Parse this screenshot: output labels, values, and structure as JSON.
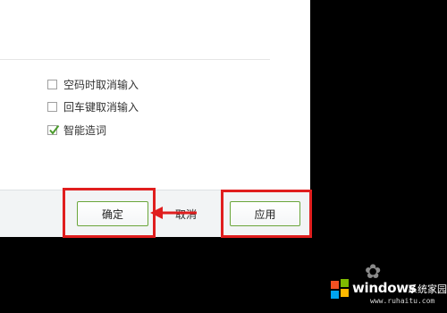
{
  "options": [
    {
      "label": "空码时取消输入",
      "checked": false
    },
    {
      "label": "回车键取消输入",
      "checked": false
    },
    {
      "label": "智能造词",
      "checked": true
    }
  ],
  "footer": {
    "confirm_label": "确定",
    "cancel_label": "取消",
    "apply_label": "应用"
  },
  "watermark": {
    "brand": "windows",
    "brand_suffix": "系统家园",
    "url": "www.ruhaitu.com"
  },
  "colors": {
    "highlight": "#e01e1e",
    "button_border": "#6aa63a",
    "checkmark": "#4c9c2e"
  }
}
